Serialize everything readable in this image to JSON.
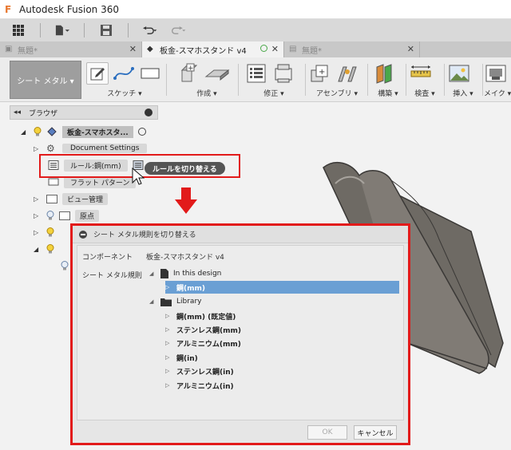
{
  "app": {
    "title": "Autodesk Fusion 360"
  },
  "tabs": [
    {
      "label": "無題*",
      "active": false
    },
    {
      "label": "板金-スマホスタンド v4",
      "active": true
    },
    {
      "label": "無題*",
      "active": false
    }
  ],
  "toolbar": {
    "workspace": "シート メタル ▾",
    "groups": [
      "スケッチ ▾",
      "作成 ▾",
      "修正 ▾",
      "アセンブリ ▾",
      "構築 ▾",
      "検査 ▾",
      "挿入 ▾",
      "メイク ▾"
    ]
  },
  "browser": {
    "title": "ブラウザ",
    "root": "板金-スマホスタ...",
    "document_settings": "Document Settings",
    "rule": "ルール:鋼(mm)",
    "flat_pattern": "フラット パターン",
    "view": "ビュー管理",
    "origin": "原点"
  },
  "tooltip": "ルールを切り替える",
  "dialog": {
    "title": "シート メタル規則を切り替える",
    "component_label": "コンポーネント",
    "component_value": "板金-スマホスタンド v4",
    "rule_label": "シート メタル規則",
    "in_design_label": "In this design",
    "in_design_items": [
      "鋼(mm)"
    ],
    "library_label": "Library",
    "library_items": [
      "鋼(mm) (既定値)",
      "ステンレス鋼(mm)",
      "アルミニウム(mm)",
      "鋼(in)",
      "ステンレス鋼(in)",
      "アルミニウム(in)"
    ],
    "ok": "OK",
    "cancel": "キャンセル"
  },
  "colors": {
    "highlight": "#e21a1a",
    "selection": "#6a9fd4",
    "accent": "#e8772e"
  }
}
